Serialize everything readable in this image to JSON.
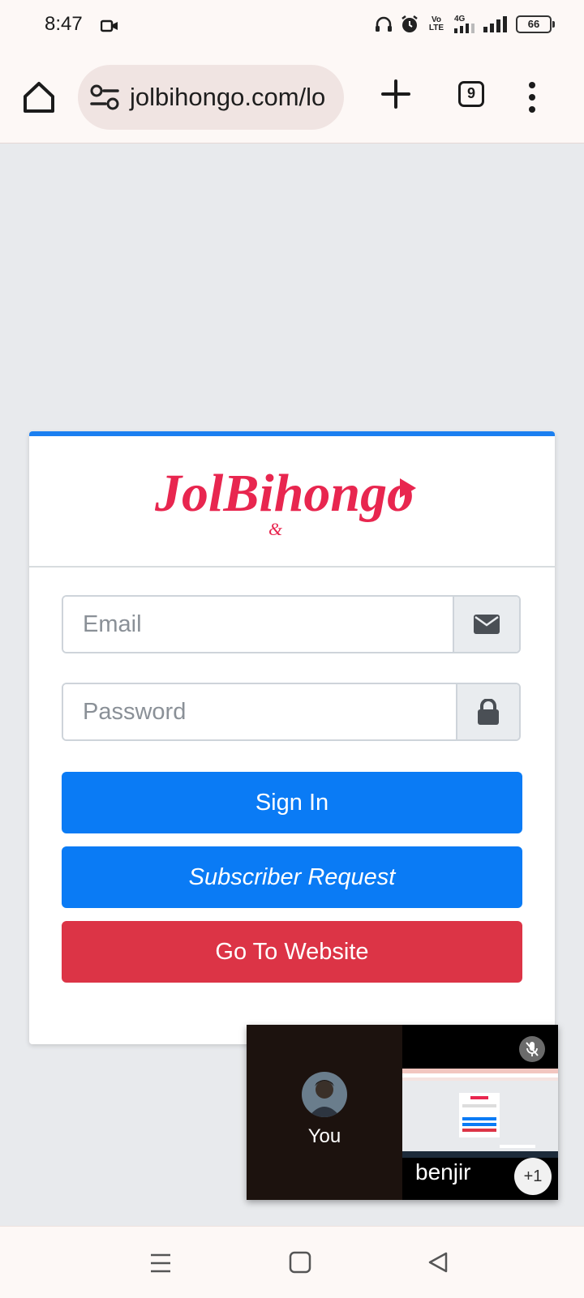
{
  "status_bar": {
    "time": "8:47",
    "volte": "Vo LTE",
    "network": "4G",
    "battery": "66"
  },
  "browser": {
    "url": "jolbihongo.com/lo",
    "tab_count": "9"
  },
  "login": {
    "logo_text": "JolBihongo",
    "email_placeholder": "Email",
    "password_placeholder": "Password",
    "signin_label": "Sign In",
    "subscriber_label": "Subscriber Request",
    "website_label": "Go To Website"
  },
  "call": {
    "self_label": "You",
    "participant_name": "benjir",
    "more_count": "+1"
  },
  "colors": {
    "primary": "#0a7bf5",
    "danger": "#dc3446",
    "logo": "#e8264f",
    "card_top": "#1b7ff0"
  }
}
